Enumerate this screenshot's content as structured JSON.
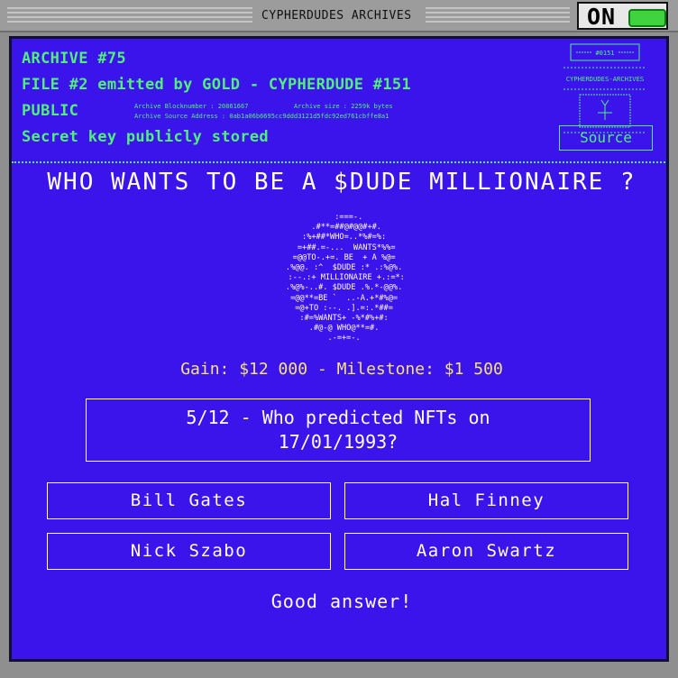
{
  "window": {
    "title": "CYPHERDUDES ARCHIVES",
    "power_label": "ON",
    "power_color": "#3fd43f"
  },
  "header": {
    "archive": "ARCHIVE #75",
    "file": "FILE #2 emitted by GOLD - CYPHERDUDE #151",
    "visibility": "PUBLIC",
    "secret": "Secret key publicly stored",
    "block_number": "Archive Blocknumber : 20861667",
    "archive_size": "Archive size : 2259k bytes",
    "source_address": "Archive Source Address : 0ab1a06b6695cc9ddd3121d5fdc92ed761cbffe8a1",
    "source_button": "Source",
    "logo_id": "#0151",
    "logo_caption": "CYPHERDUDES-ARCHIVES",
    "accent_color": "#52ef7a"
  },
  "game": {
    "title": "WHO WANTS TO BE A $DUDE MILLIONAIRE ?",
    "ascii_art": "   :===-.\n  .#**=##@#@@#+#.\n :%+##*WHO=..*%#=%:\n  =+##.=-...  WANTS*%%=\n =@@TO-.+=. BE  + A %@=\n .%@@. :^  $DUDE :* .:%@%.\n  :--.:+ MILLIONAIRE +.:=*:\n .%@%-..#. $DUDE .%.*-@@%.\n =@@**=BE `  ..-A.+*#%@=\n =@+TO :--. .].=:.*##=\n :#=%WANTS+ -%*#%+#:\n .#@-@ WHO@**=#.\n .-=+=-.",
    "gain": "Gain: $12 000 - Milestone: $1 500",
    "question": "5/12 - Who predicted NFTs on 17/01/1993?",
    "answers": [
      "Bill Gates",
      "Hal Finney",
      "Nick Szabo",
      "Aaron Swartz"
    ],
    "result": "Good answer!",
    "gain_color": "#f6e27a",
    "screen_color": "#3a14ea"
  }
}
